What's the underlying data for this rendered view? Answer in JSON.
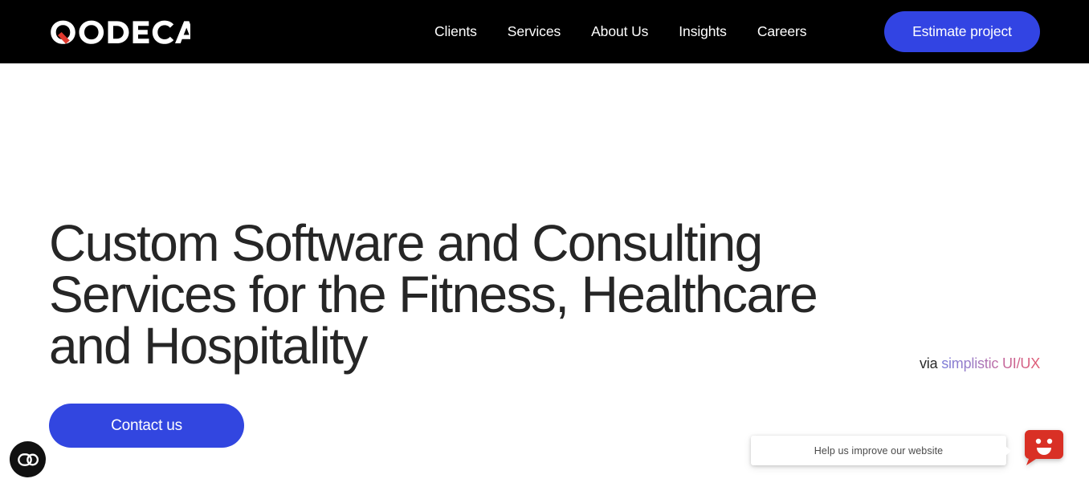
{
  "header": {
    "logo": {
      "text": "QODECA",
      "accent_color": "#e0392e",
      "text_color": "#ffffff",
      "icon": "qodeca-logo"
    },
    "background_color": "#000000",
    "nav": [
      {
        "label": "Clients"
      },
      {
        "label": "Services"
      },
      {
        "label": "About Us"
      },
      {
        "label": "Insights"
      },
      {
        "label": "Careers"
      }
    ],
    "cta": {
      "label": "Estimate project",
      "background_color": "#3244e3",
      "text_color": "#ffffff"
    }
  },
  "hero": {
    "headline": "Custom Software and Consulting\nServices for the Fitness, Healthcare\nand Hospitality",
    "via": {
      "prefix": "via ",
      "gradient_text": "simplistic UI/UX",
      "gradient_from": "#7b7bd8",
      "gradient_to": "#e05a72"
    },
    "cta": {
      "label": "Contact us",
      "background_color": "#3246e0",
      "text_color": "#ffffff"
    }
  },
  "accessibility_widget": {
    "icon": "accessibility-toggle-icon",
    "background_color": "#111111",
    "icon_color": "#ffffff"
  },
  "feedback_widget": {
    "tooltip_label": "Help us improve our website",
    "icon": "smiley-face-icon",
    "color": "#d93025"
  }
}
